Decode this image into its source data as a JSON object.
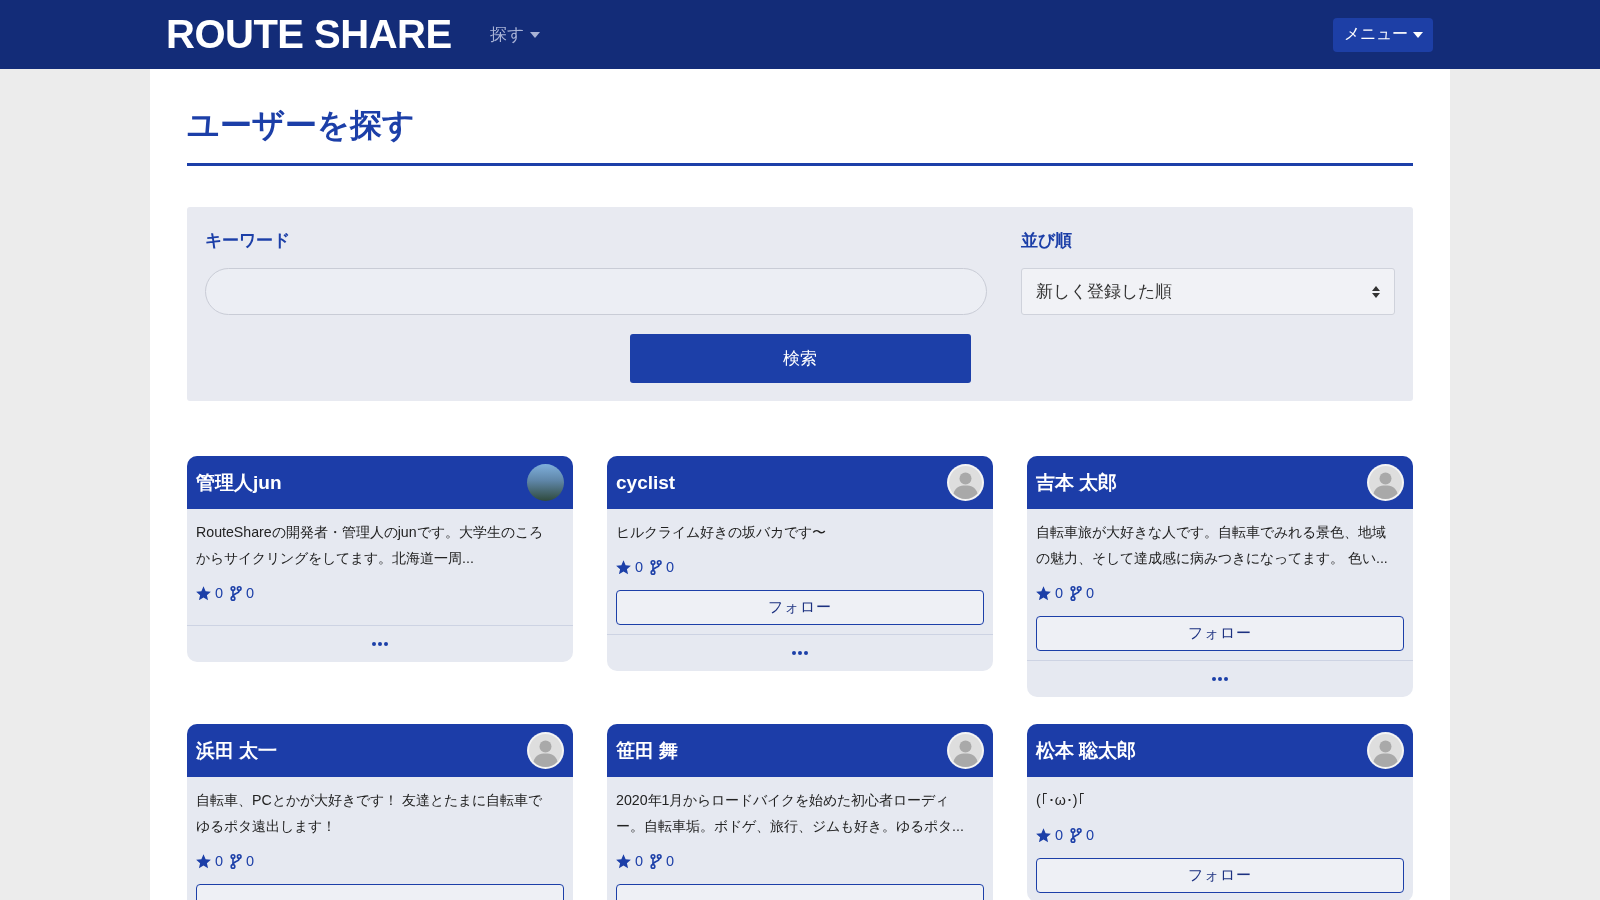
{
  "navbar": {
    "logo": "ROUTE SHARE",
    "links": [
      {
        "label": "探す",
        "dropdown": true
      }
    ],
    "menu_button": {
      "label": "メニュー",
      "dropdown": true
    }
  },
  "page_title": "ユーザーを探す",
  "search_form": {
    "keyword_field": {
      "label": "キーワード"
    },
    "sort_field": {
      "label": "並び順",
      "value": "新しく登録した順"
    },
    "submit_button": "検索"
  },
  "users": [
    {
      "name": "管理人jun",
      "avatar": {
        "kind": "photo"
      },
      "bio": "RouteShareの開発者・管理人のjunです。大学生のころからサイクリングをしてます。北海道一周...",
      "star_count": "0",
      "branch_count": "0",
      "follow_button": false,
      "more_button": true
    },
    {
      "name": "cyclist",
      "avatar": {
        "kind": "default"
      },
      "bio": "ヒルクライム好きの坂バカです〜",
      "star_count": "0",
      "branch_count": "0",
      "follow_button": true,
      "follow_label": "フォロー",
      "more_button": true
    },
    {
      "name": "吉本 太郎",
      "avatar": {
        "kind": "default"
      },
      "bio": "自転車旅が大好きな人です。自転車でみれる景色、地域の魅力、そして達成感に病みつきになってます。 色い...",
      "star_count": "0",
      "branch_count": "0",
      "follow_button": true,
      "follow_label": "フォロー",
      "more_button": true
    },
    {
      "name": "浜田 太一",
      "avatar": {
        "kind": "default"
      },
      "bio": "自転車、PCとかが大好きです！ 友達とたまに自転車でゆるポタ遠出します！",
      "star_count": "0",
      "branch_count": "0",
      "follow_button": true
    },
    {
      "name": "笹田 舞",
      "avatar": {
        "kind": "default"
      },
      "bio": "2020年1月からロードバイクを始めた初心者ローディー。自転車垢。ボドゲ、旅行、ジムも好き。ゆるポタ...",
      "star_count": "0",
      "branch_count": "0",
      "follow_button": true
    },
    {
      "name": "松本 聡太郎",
      "avatar": {
        "kind": "default"
      },
      "bio": "(｢･ω･)｢",
      "star_count": "0",
      "branch_count": "0",
      "follow_button": true,
      "follow_label": "フォロー"
    }
  ]
}
